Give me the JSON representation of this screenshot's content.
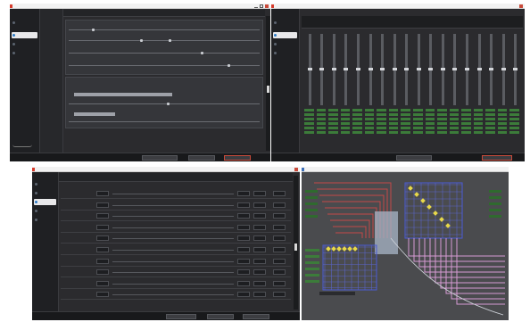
{
  "screens": {
    "top_left": {
      "sidebar": {
        "items": [
          {
            "label": "",
            "active": false
          },
          {
            "label": "",
            "active": false
          },
          {
            "label": "",
            "active": true
          },
          {
            "label": "",
            "active": false
          },
          {
            "label": "",
            "active": false
          }
        ]
      }
    },
    "top_right": {
      "sidebar": {
        "items": [
          {
            "label": "",
            "active": false
          },
          {
            "label": "",
            "active": false
          },
          {
            "label": "",
            "active": true
          },
          {
            "label": "",
            "active": false
          },
          {
            "label": "",
            "active": false
          }
        ]
      }
    },
    "bottom_left": {
      "sidebar": {
        "items": [
          {
            "label": "",
            "active": false
          },
          {
            "label": "",
            "active": false
          },
          {
            "label": "",
            "active": true
          },
          {
            "label": "",
            "active": false
          },
          {
            "label": "",
            "active": false
          }
        ]
      }
    },
    "bottom_right": {
      "titlebar": {
        "label": ""
      }
    }
  },
  "colors": {
    "panel_bg": "#2b2b2e",
    "accent_red": "#d63a2a",
    "routing_red": "#c44848",
    "routing_blue": "#4a5bd6",
    "routing_pink": "#d79bd4",
    "routing_yellow": "#e7d84a",
    "matrix_green": "#3c7c3a"
  },
  "icons": [
    "app-logo-icon",
    "minimize-icon",
    "maximize-icon",
    "close-icon"
  ]
}
